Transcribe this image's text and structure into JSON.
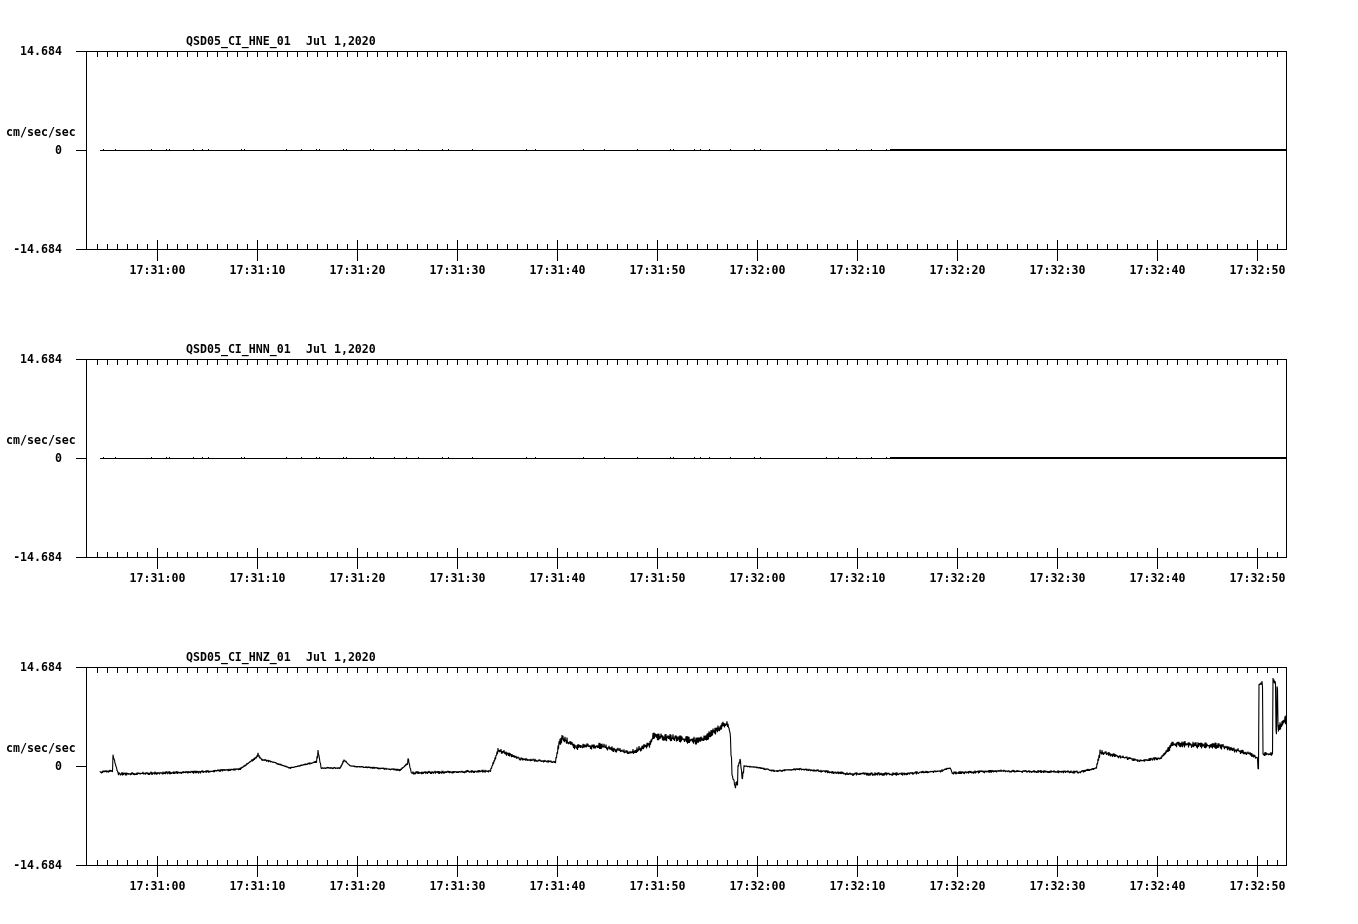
{
  "panels": [
    {
      "channel": "QSD05_CI_HNE_01",
      "date": "Jul 1,2020",
      "unit": "cm/sec/sec",
      "y_ticks": [
        "14.684",
        "0",
        "-14.684"
      ],
      "x_ticks": [
        "17:31:00",
        "17:31:10",
        "17:31:20",
        "17:31:30",
        "17:31:40",
        "17:31:50",
        "17:32:00",
        "17:32:10",
        "17:32:20",
        "17:32:30",
        "17:32:40",
        "17:32:50"
      ],
      "kind": "quiet"
    },
    {
      "channel": "QSD05_CI_HNN_01",
      "date": "Jul 1,2020",
      "unit": "cm/sec/sec",
      "y_ticks": [
        "14.684",
        "0",
        "-14.684"
      ],
      "x_ticks": [
        "17:31:00",
        "17:31:10",
        "17:31:20",
        "17:31:30",
        "17:31:40",
        "17:31:50",
        "17:32:00",
        "17:32:10",
        "17:32:20",
        "17:32:30",
        "17:32:40",
        "17:32:50"
      ],
      "kind": "quiet"
    },
    {
      "channel": "QSD05_CI_HNZ_01",
      "date": "Jul 1,2020",
      "unit": "cm/sec/sec",
      "y_ticks": [
        "14.684",
        "0",
        "-14.684"
      ],
      "x_ticks": [
        "17:31:00",
        "17:31:10",
        "17:31:20",
        "17:31:30",
        "17:31:40",
        "17:31:50",
        "17:32:00",
        "17:32:10",
        "17:32:20",
        "17:32:30",
        "17:32:40",
        "17:32:50"
      ],
      "kind": "active"
    }
  ]
}
